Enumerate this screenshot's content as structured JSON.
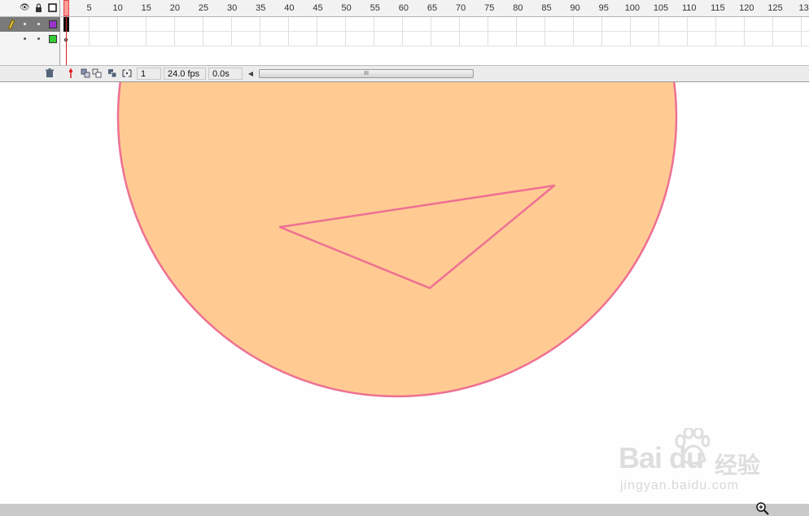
{
  "timeline": {
    "ruler_ticks": [
      "5",
      "10",
      "15",
      "20",
      "25",
      "30",
      "35",
      "40",
      "45",
      "50",
      "55",
      "60",
      "65",
      "70",
      "75",
      "80",
      "85",
      "90",
      "95",
      "100",
      "105",
      "110",
      "115",
      "120",
      "125",
      "13"
    ],
    "playhead_frame": "1",
    "layers": [
      {
        "selected": true,
        "color": "#9933cc"
      },
      {
        "selected": false,
        "color": "#33cc33"
      }
    ],
    "header_icons": [
      "eye-icon",
      "lock-icon",
      "outline-icon"
    ]
  },
  "status_bar": {
    "current_frame": "1",
    "frame_rate": "24.0 fps",
    "elapsed_time": "0.0s",
    "scroll_thumb_grip": "III"
  },
  "stage": {
    "circle_fill": "#ffcb93",
    "stroke_color": "#ee7092"
  },
  "watermark": {
    "brand": "Bai du",
    "brand_cn": "经验",
    "url": "jingyan.baidu.com"
  }
}
